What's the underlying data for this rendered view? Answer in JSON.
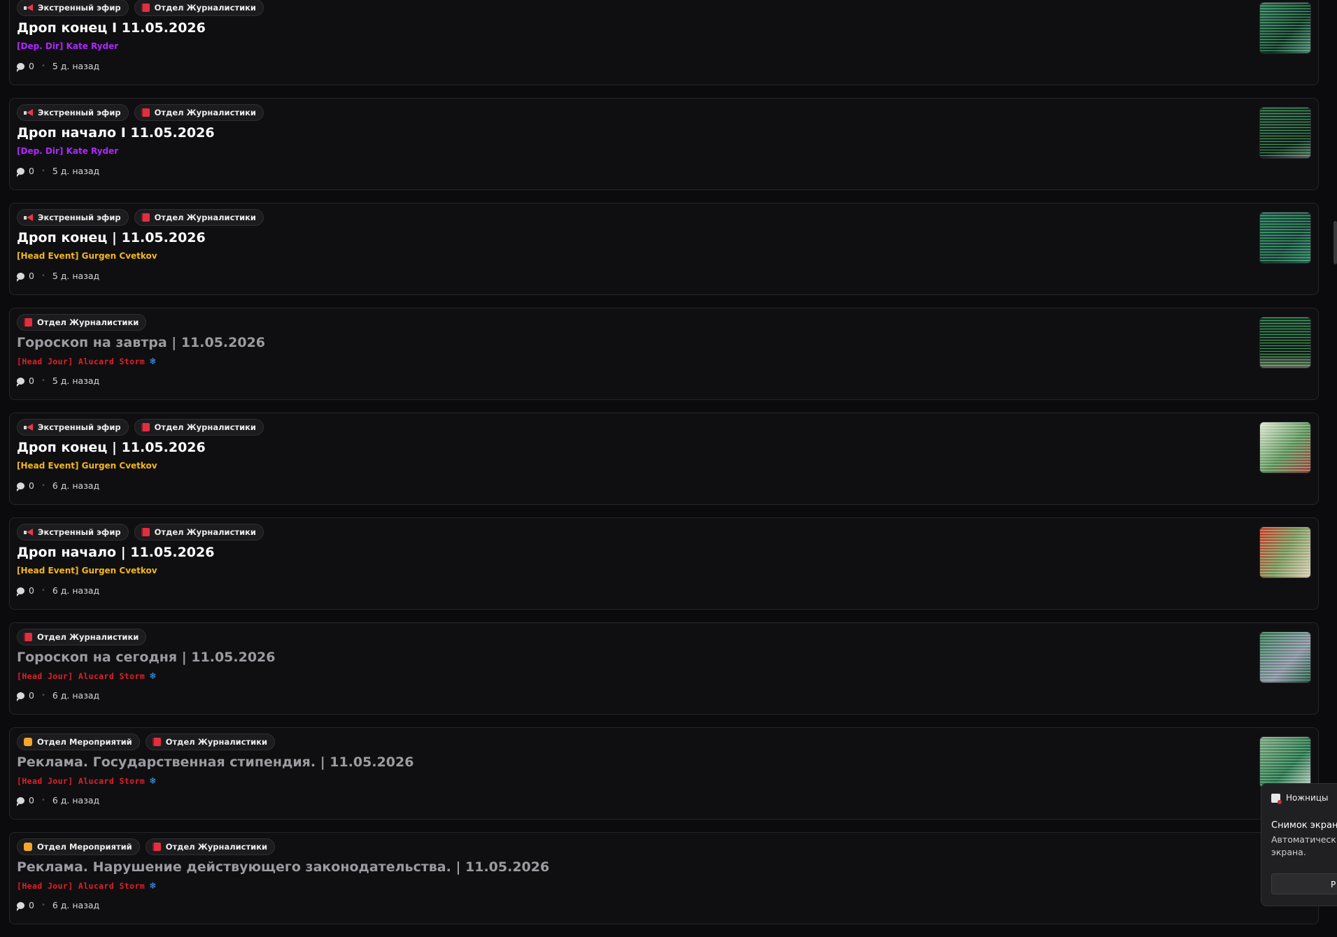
{
  "colors": {
    "background": "#0b0b0d",
    "card": "#0f0f11",
    "author_purple": "#a020f0",
    "author_gold": "#f3b61f",
    "author_red": "#e0202a",
    "snowflake_blue": "#3aa0ff"
  },
  "posts": [
    {
      "tags": [
        {
          "icon": "megaphone-icon",
          "label": "Экстренный эфир"
        },
        {
          "icon": "book-icon",
          "label": "Отдел Журналистики"
        }
      ],
      "title": "Дроп конец I 11.05.2026",
      "author": "[Dep. Dir] Kate Ryder",
      "author_color": "#b026ff",
      "author_style": "normal",
      "comments": "0",
      "time": "5 д. назад",
      "muted": false,
      "thumb": "t1"
    },
    {
      "tags": [
        {
          "icon": "megaphone-icon",
          "label": "Экстренный эфир"
        },
        {
          "icon": "book-icon",
          "label": "Отдел Журналистики"
        }
      ],
      "title": "Дроп начало I 11.05.2026",
      "author": "[Dep. Dir] Kate Ryder",
      "author_color": "#b026ff",
      "author_style": "normal",
      "comments": "0",
      "time": "5 д. назад",
      "muted": false,
      "thumb": "t2"
    },
    {
      "tags": [
        {
          "icon": "megaphone-icon",
          "label": "Экстренный эфир"
        },
        {
          "icon": "book-icon",
          "label": "Отдел Журналистики"
        }
      ],
      "title": "Дроп конец | 11.05.2026",
      "author": "[Head Event] Gurgen Cvetkov",
      "author_color": "#f3b61f",
      "author_style": "normal",
      "comments": "0",
      "time": "5 д. назад",
      "muted": false,
      "thumb": "t3"
    },
    {
      "tags": [
        {
          "icon": "book-icon",
          "label": "Отдел Журналистики"
        }
      ],
      "title": "Гороскоп на завтра | 11.05.2026",
      "author": "[Head Jour] Alucard Storm",
      "author_color": "#e0202a",
      "author_style": "pixel",
      "snowflake": "❄",
      "comments": "0",
      "time": "5 д. назад",
      "muted": true,
      "thumb": "t4"
    },
    {
      "tags": [
        {
          "icon": "megaphone-icon",
          "label": "Экстренный эфир"
        },
        {
          "icon": "book-icon",
          "label": "Отдел Журналистики"
        }
      ],
      "title": "Дроп конец | 11.05.2026",
      "author": "[Head Event] Gurgen Cvetkov",
      "author_color": "#f3b61f",
      "author_style": "normal",
      "comments": "0",
      "time": "6 д. назад",
      "muted": false,
      "thumb": "t5"
    },
    {
      "tags": [
        {
          "icon": "megaphone-icon",
          "label": "Экстренный эфир"
        },
        {
          "icon": "book-icon",
          "label": "Отдел Журналистики"
        }
      ],
      "title": "Дроп начало | 11.05.2026",
      "author": "[Head Event] Gurgen Cvetkov",
      "author_color": "#f3b61f",
      "author_style": "normal",
      "comments": "0",
      "time": "6 д. назад",
      "muted": false,
      "thumb": "t6"
    },
    {
      "tags": [
        {
          "icon": "book-icon",
          "label": "Отдел Журналистики"
        }
      ],
      "title": "Гороскоп на сегодня | 11.05.2026",
      "author": "[Head Jour] Alucard Storm",
      "author_color": "#e0202a",
      "author_style": "pixel",
      "snowflake": "❄",
      "comments": "0",
      "time": "6 д. назад",
      "muted": true,
      "thumb": "t7"
    },
    {
      "tags": [
        {
          "icon": "folder-icon",
          "label": "Отдел Мероприятий"
        },
        {
          "icon": "book-icon",
          "label": "Отдел Журналистики"
        }
      ],
      "title": "Реклама. Государственная стипендия. | 11.05.2026",
      "author": "[Head Jour] Alucard Storm",
      "author_color": "#e0202a",
      "author_style": "pixel",
      "snowflake": "❄",
      "comments": "0",
      "time": "6 д. назад",
      "muted": true,
      "thumb": "t8"
    },
    {
      "tags": [
        {
          "icon": "folder-icon",
          "label": "Отдел Мероприятий"
        },
        {
          "icon": "book-icon",
          "label": "Отдел Журналистики"
        }
      ],
      "title": "Реклама. Нарушение действующего законодательства. | 11.05.2026",
      "author": "[Head Jour] Alucard Storm",
      "author_color": "#e0202a",
      "author_style": "pixel",
      "snowflake": "❄",
      "comments": "0",
      "time": "6 д. назад",
      "muted": true,
      "thumb": ""
    }
  ],
  "toast": {
    "app_name": "Ножницы",
    "title": "Снимок экрана",
    "body": "Автоматическ\nэкрана.",
    "button_label": "Р"
  }
}
